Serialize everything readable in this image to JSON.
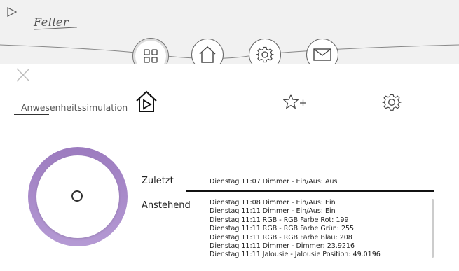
{
  "app": {
    "brand": "Feller"
  },
  "nav": {
    "items": [
      {
        "name": "dashboard",
        "icon": "grid-icon",
        "active": true
      },
      {
        "name": "home",
        "icon": "house-icon",
        "active": false
      },
      {
        "name": "settings",
        "icon": "gear-icon",
        "active": false
      },
      {
        "name": "messages",
        "icon": "envelope-icon",
        "active": false
      }
    ]
  },
  "panel": {
    "tab_label": "Anwesenheitssimulation",
    "header_icons": [
      "house-play-icon",
      "star-plus-icon",
      "gear-icon"
    ]
  },
  "simulation": {
    "last_label": "Zuletzt",
    "last_event": "Dienstag 11:07 Dimmer - Ein/Aus: Aus",
    "pending_label": "Anstehend",
    "pending_events": [
      "Dienstag 11:08 Dimmer - Ein/Aus: Ein",
      "Dienstag 11:11 Dimmer - Ein/Aus: Ein",
      "Dienstag 11:11 RGB - RGB Farbe Rot: 199",
      "Dienstag 11:11 RGB - RGB Farbe Grün: 255",
      "Dienstag 11:11 RGB - RGB Farbe Blau: 208",
      "Dienstag 11:11 Dimmer - Dimmer: 23.9216",
      "Dienstag 11:11 Jalousie - Jalousie Position: 49.0196"
    ]
  },
  "colors": {
    "knob_ring": "#a98bc9",
    "topbar_bg": "#f1f1f1"
  }
}
